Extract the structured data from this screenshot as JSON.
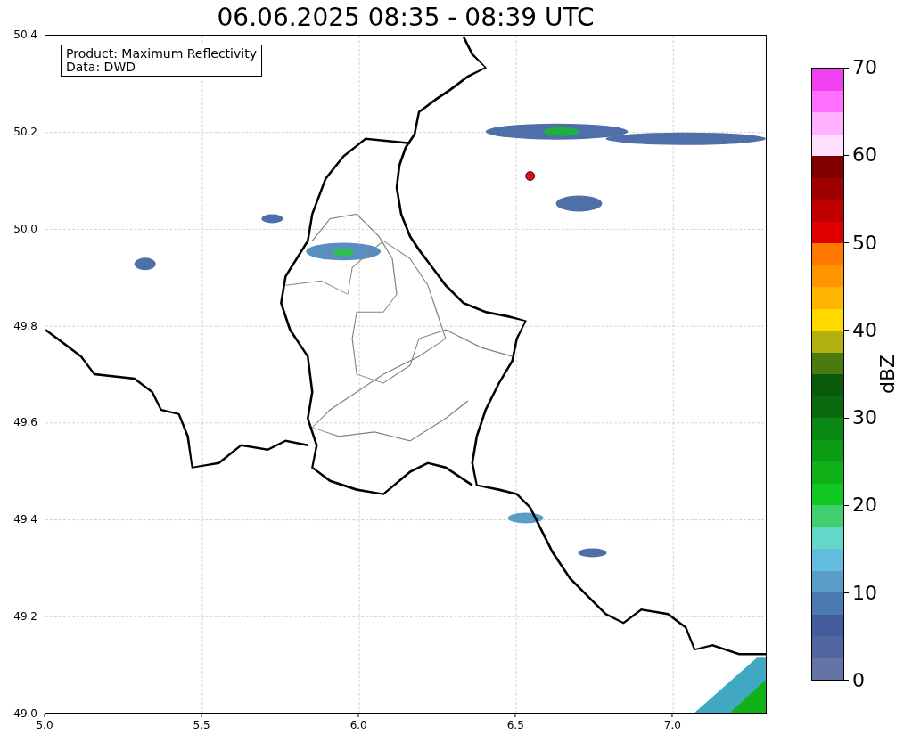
{
  "title": "06.06.2025 08:35 - 08:39 UTC",
  "info_box": {
    "lines": [
      "Product: Maximum Reflectivity",
      "Data: DWD"
    ]
  },
  "y_ticks": [
    "50.4",
    "50.2",
    "50.0",
    "49.8",
    "49.6",
    "49.4",
    "49.2",
    "49.0"
  ],
  "x_ticks": [
    "5.0",
    "5.5",
    "6.0",
    "6.5",
    "7.0"
  ],
  "colorbar": {
    "label": "dBZ",
    "ticks": [
      "70",
      "60",
      "50",
      "40",
      "30",
      "20",
      "10",
      "0"
    ],
    "segments": [
      {
        "color": "#f040f0"
      },
      {
        "color": "#ff70ff"
      },
      {
        "color": "#ffb0ff"
      },
      {
        "color": "#ffe0ff"
      },
      {
        "color": "#800000"
      },
      {
        "color": "#a00000"
      },
      {
        "color": "#c00000"
      },
      {
        "color": "#e00000"
      },
      {
        "color": "#ff7800"
      },
      {
        "color": "#ff9600"
      },
      {
        "color": "#ffb400"
      },
      {
        "color": "#ffd800"
      },
      {
        "color": "#b0b010"
      },
      {
        "color": "#4a7a10"
      },
      {
        "color": "#0a5a0c"
      },
      {
        "color": "#0a6a10"
      },
      {
        "color": "#0a8a14"
      },
      {
        "color": "#0c9c14"
      },
      {
        "color": "#10b018"
      },
      {
        "color": "#10c820"
      },
      {
        "color": "#40d070"
      },
      {
        "color": "#64d8c8"
      },
      {
        "color": "#62bcdc"
      },
      {
        "color": "#5a9ec8"
      },
      {
        "color": "#4a7ab0"
      },
      {
        "color": "#425c9e"
      },
      {
        "color": "#5366a0"
      },
      {
        "color": "#6474a4"
      }
    ]
  }
}
